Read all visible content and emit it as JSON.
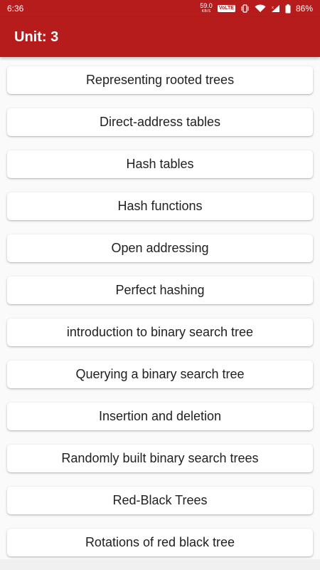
{
  "status_bar": {
    "time": "6:36",
    "net_speed_value": "59.0",
    "net_speed_unit": "KB/S",
    "volte_label": "VoLTE",
    "battery_percent": "86%",
    "icons": [
      "vibrate-icon",
      "wifi-icon",
      "signal-icon",
      "battery-icon"
    ]
  },
  "app_bar": {
    "title": "Unit: 3",
    "color": "#b71c1c"
  },
  "topics": [
    {
      "label": "Representing rooted trees"
    },
    {
      "label": "Direct-address tables"
    },
    {
      "label": "Hash tables"
    },
    {
      "label": "Hash functions"
    },
    {
      "label": "Open addressing"
    },
    {
      "label": "Perfect hashing"
    },
    {
      "label": "introduction to binary search tree"
    },
    {
      "label": "Querying a binary search tree"
    },
    {
      "label": "Insertion and deletion"
    },
    {
      "label": "Randomly built binary search trees"
    },
    {
      "label": "Red-Black Trees"
    },
    {
      "label": "Rotations of red black tree"
    }
  ]
}
